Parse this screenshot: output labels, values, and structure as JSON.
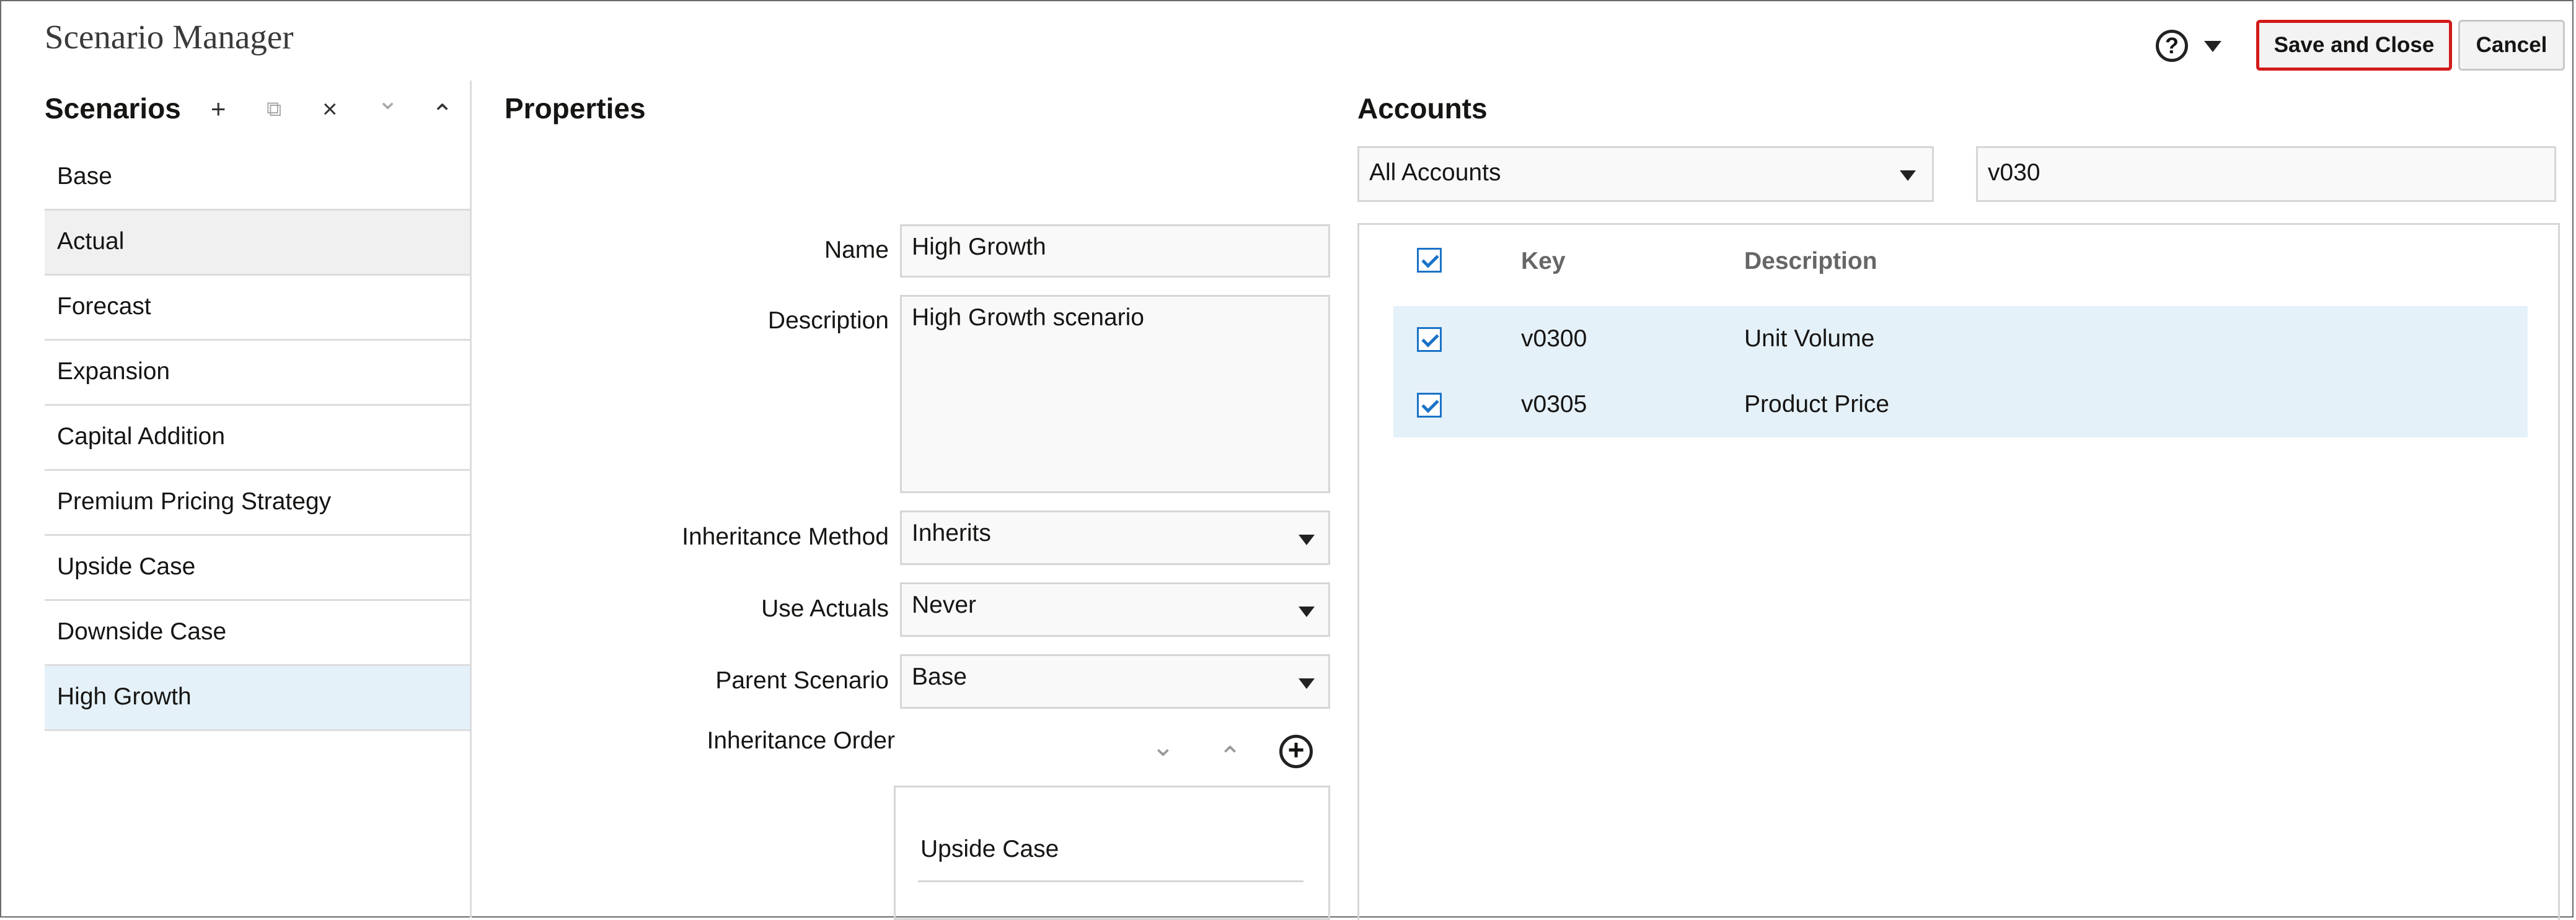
{
  "window": {
    "title": "Scenario Manager"
  },
  "header": {
    "help_icon": "question-circle-icon",
    "help_glyph": "?",
    "save_label": "Save and Close",
    "cancel_label": "Cancel"
  },
  "scenarios": {
    "title": "Scenarios",
    "toolbar": {
      "add_glyph": "+",
      "copy_glyph": "⧉",
      "delete_glyph": "×",
      "move_down_glyph": "⌄",
      "move_up_glyph": "⌃"
    },
    "items": [
      {
        "label": "Base"
      },
      {
        "label": "Actual"
      },
      {
        "label": "Forecast"
      },
      {
        "label": "Expansion"
      },
      {
        "label": "Capital Addition"
      },
      {
        "label": "Premium Pricing Strategy"
      },
      {
        "label": "Upside Case"
      },
      {
        "label": "Downside Case"
      },
      {
        "label": "High Growth"
      }
    ],
    "selected": "High Growth"
  },
  "properties": {
    "title": "Properties",
    "name_label": "Name",
    "name_value": "High Growth",
    "description_label": "Description",
    "description_value": "High Growth scenario",
    "inheritance_method_label": "Inheritance Method",
    "inheritance_method_value": "Inherits",
    "use_actuals_label": "Use Actuals",
    "use_actuals_value": "Never",
    "parent_scenario_label": "Parent Scenario",
    "parent_scenario_value": "Base",
    "inheritance_order_label": "Inheritance Order",
    "inheritance_order_items": [
      "Upside Case"
    ],
    "io_down_glyph": "⌄",
    "io_up_glyph": "⌃",
    "io_add_glyph": "+"
  },
  "accounts": {
    "title": "Accounts",
    "filter_value": "All Accounts",
    "search_value": "v030",
    "columns": {
      "key": "Key",
      "description": "Description"
    },
    "rows": [
      {
        "key": "v0300",
        "description": "Unit Volume",
        "checked": true
      },
      {
        "key": "v0305",
        "description": "Product Price",
        "checked": true
      }
    ]
  },
  "colors": {
    "selection": "#e5f1f9",
    "accent_check": "#1a73c8",
    "save_border": "#d21a1a"
  }
}
